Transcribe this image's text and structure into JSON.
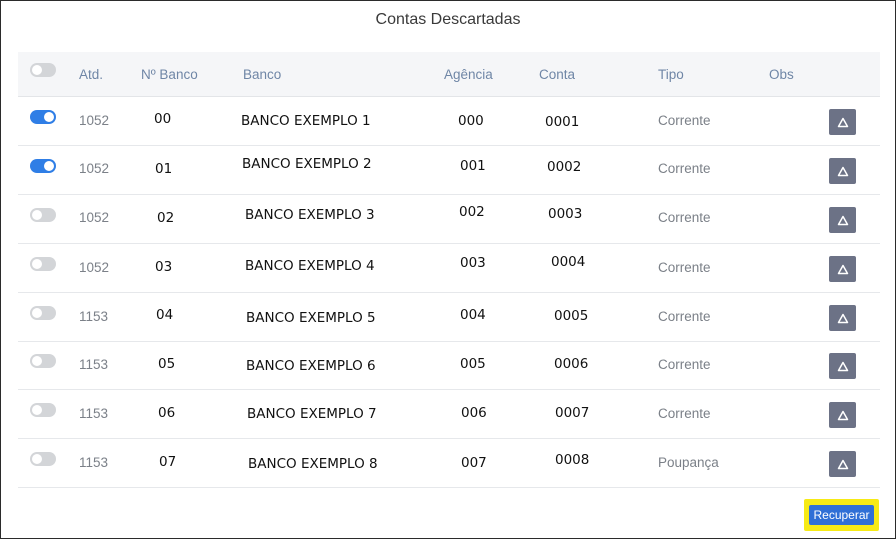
{
  "title": "Contas Descartadas",
  "columns": {
    "atd": "Atd.",
    "nbanco": "Nº Banco",
    "banco": "Banco",
    "agencia": "Agência",
    "conta": "Conta",
    "tipo": "Tipo",
    "obs": "Obs"
  },
  "header_toggle_on": false,
  "rows": [
    {
      "selected": true,
      "atd": "1052",
      "nbanco": "00",
      "banco": "BANCO EXEMPLO 1",
      "agencia": "000",
      "conta": "0001",
      "tipo": "Corrente"
    },
    {
      "selected": true,
      "atd": "1052",
      "nbanco": "01",
      "banco": "BANCO EXEMPLO 2",
      "agencia": "001",
      "conta": "0002",
      "tipo": "Corrente"
    },
    {
      "selected": false,
      "atd": "1052",
      "nbanco": "02",
      "banco": "BANCO EXEMPLO 3",
      "agencia": "002",
      "conta": "0003",
      "tipo": "Corrente"
    },
    {
      "selected": false,
      "atd": "1052",
      "nbanco": "03",
      "banco": "BANCO EXEMPLO 4",
      "agencia": "003",
      "conta": "0004",
      "tipo": "Corrente"
    },
    {
      "selected": false,
      "atd": "1153",
      "nbanco": "04",
      "banco": "BANCO EXEMPLO 5",
      "agencia": "004",
      "conta": "0005",
      "tipo": "Corrente"
    },
    {
      "selected": false,
      "atd": "1153",
      "nbanco": "05",
      "banco": "BANCO EXEMPLO 6",
      "agencia": "005",
      "conta": "0006",
      "tipo": "Corrente"
    },
    {
      "selected": false,
      "atd": "1153",
      "nbanco": "06",
      "banco": "BANCO EXEMPLO 7",
      "agencia": "006",
      "conta": "0007",
      "tipo": "Corrente"
    },
    {
      "selected": false,
      "atd": "1153",
      "nbanco": "07",
      "banco": "BANCO EXEMPLO 8",
      "agencia": "007",
      "conta": "0008",
      "tipo": "Poupança"
    }
  ],
  "obs_icon": "triangle-warning-icon",
  "recuperar_label": "Recuperar",
  "colors": {
    "toggle_on": "#2f7ee6",
    "toggle_off": "#d3d5d8",
    "obs_button": "#6c7286",
    "recuperar_button": "#2f6fd6",
    "highlight": "#f6ea16"
  }
}
